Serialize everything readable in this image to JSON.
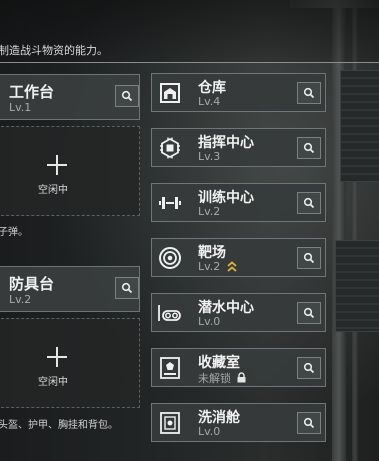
{
  "description": "制造战斗物资的能力。",
  "workshops": [
    {
      "name": "工作台",
      "level": "Lv.1",
      "slot_label": "空闲中",
      "footer": "子弹。"
    },
    {
      "name": "防具台",
      "level": "Lv.2",
      "slot_label": "空闲中",
      "footer": "头盔、护甲、胸挂和背包。"
    }
  ],
  "facilities": [
    {
      "name": "仓库",
      "status": "Lv.4",
      "icon": "warehouse-icon"
    },
    {
      "name": "指挥中心",
      "status": "Lv.3",
      "icon": "chip-icon"
    },
    {
      "name": "训练中心",
      "status": "Lv.2",
      "icon": "dumbbell-icon"
    },
    {
      "name": "靶场",
      "status": "Lv.2",
      "icon": "target-icon",
      "badge": "upgrade-available-icon"
    },
    {
      "name": "潜水中心",
      "status": "Lv.0",
      "icon": "diving-icon"
    },
    {
      "name": "收藏室",
      "status": "未解锁",
      "icon": "collection-icon",
      "badge": "lock-icon"
    },
    {
      "name": "洗消舱",
      "status": "Lv.0",
      "icon": "decon-icon"
    }
  ],
  "colors": {
    "accent_upgrade": "#e2b63f",
    "panel": "#3a3e3e",
    "border": "#6f7473"
  }
}
